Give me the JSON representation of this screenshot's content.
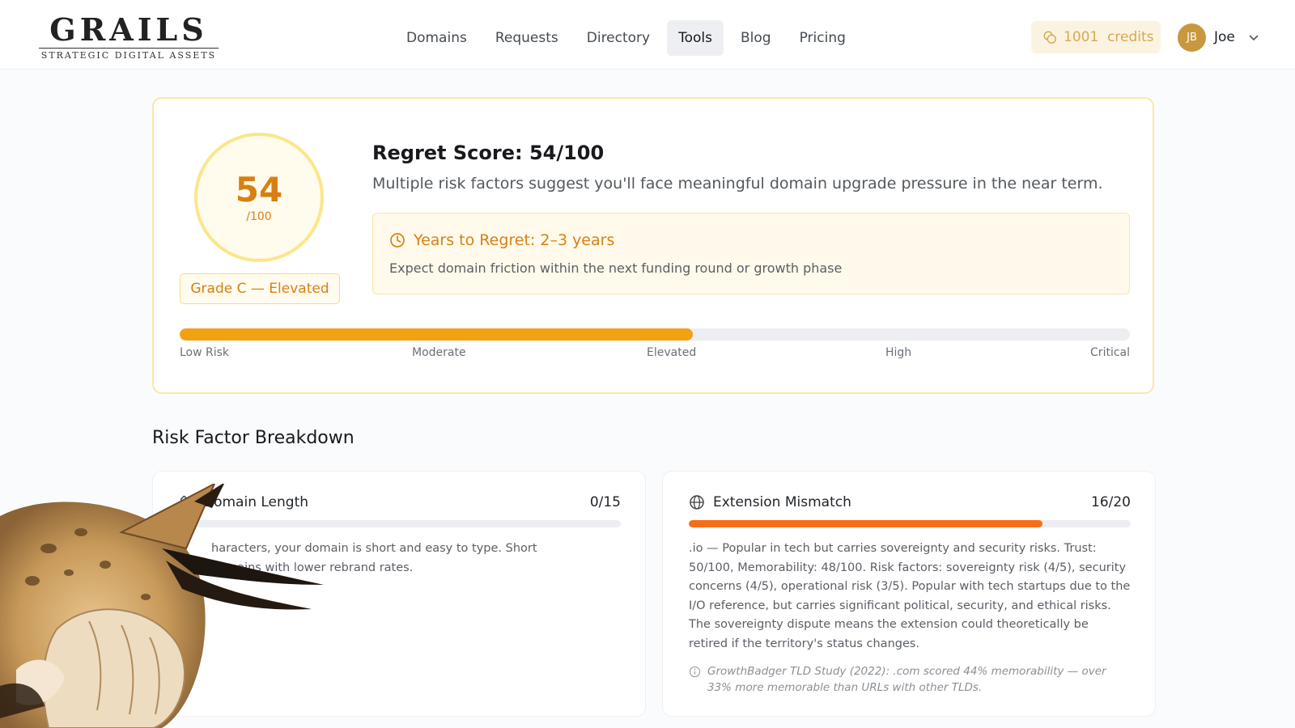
{
  "logo": {
    "word": "GRAILS",
    "tagline": "STRATEGIC DIGITAL ASSETS"
  },
  "nav": {
    "items": [
      "Domains",
      "Requests",
      "Directory",
      "Tools",
      "Blog",
      "Pricing"
    ],
    "active": "Tools"
  },
  "credits": {
    "label": "1001  credits",
    "icon": "coin-icon",
    "color": "#d9a84e"
  },
  "user": {
    "initials": "JB",
    "name": "Joe",
    "avatar_color": "#c9973d"
  },
  "score": {
    "value": "54",
    "max": "/100",
    "fraction": 0.54,
    "grade": "Grade C — Elevated",
    "title": "Regret Score: 54/100",
    "description": "Multiple risk factors suggest you'll face meaningful domain upgrade pressure in the near term.",
    "regret_title": "Years to Regret: 2–3 years",
    "regret_subtitle": "Expect domain friction within the next funding round or growth phase",
    "risk_levels": [
      "Low Risk",
      "Moderate",
      "Elevated",
      "High",
      "Critical"
    ],
    "accent_color": "#d97f12",
    "bar_color": "#f2a114"
  },
  "breakdown": {
    "title": "Risk Factor Breakdown",
    "factors": [
      {
        "name": "Domain Length",
        "score": "0/15",
        "fraction": 0.0,
        "icon": "ruler-icon",
        "text": "haracters, your domain is short and easy to type. Short domains with lower rebrand rates."
      },
      {
        "name": "Extension Mismatch",
        "score": "16/20",
        "fraction": 0.8,
        "icon": "globe-icon",
        "text": ".io — Popular in tech but carries sovereignty and security risks. Trust: 50/100, Memorability: 48/100. Risk factors: sovereignty risk (4/5), security concerns (4/5), operational risk (3/5). Popular with tech startups due to the I/O reference, but carries significant political, security, and ethical risks. The sovereignty dispute means the extension could theoretically be retired if the territory's status changes.",
        "note": "GrowthBadger TLD Study (2022): .com scored 44% memorability — over 33% more memorable than URLs with other TLDs."
      }
    ],
    "bar_color": "#f46e16"
  },
  "mascot": {
    "icon": "facepalm-lynx-icon"
  }
}
